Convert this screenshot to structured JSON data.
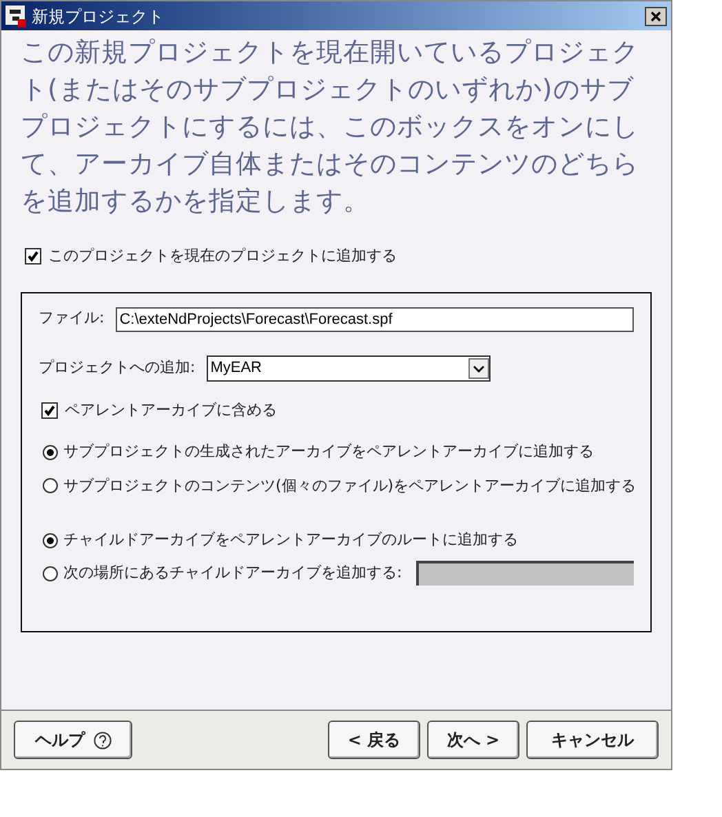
{
  "window": {
    "title": "新規プロジェクト"
  },
  "description": "この新規プロジェクトを現在開いているプロジェクト(またはそのサブプロジェクトのいずれか)のサブプロジェクトにするには、このボックスをオンにして、アーカイブ自体またはそのコンテンツのどちらを追加するかを指定します。",
  "add_to_project": {
    "label": "このプロジェクトを現在のプロジェクトに追加する",
    "checked": true
  },
  "group": {
    "file": {
      "label": "ファイル:",
      "value": "C:\\exteNdProjects\\Forecast\\Forecast.spf"
    },
    "add_to": {
      "label": "プロジェクトへの追加:",
      "value": "MyEAR"
    },
    "include_in_parent": {
      "label": "ペアレントアーカイブに含める",
      "checked": true
    },
    "content_options": [
      {
        "label": "サブプロジェクトの生成されたアーカイブをペアレントアーカイブに追加する",
        "selected": true
      },
      {
        "label": "サブプロジェクトのコンテンツ(個々のファイル)をペアレントアーカイブに追加する",
        "selected": false
      }
    ],
    "location_options": [
      {
        "label": "チャイルドアーカイブをペアレントアーカイブのルートに追加する",
        "selected": true,
        "disabled_field": false
      },
      {
        "label": "次の場所にあるチャイルドアーカイブを追加する:",
        "selected": false,
        "disabled_field": true
      }
    ]
  },
  "buttons": {
    "help": "ヘルプ",
    "back": "< 戻る",
    "next": "次へ >",
    "cancel": "キャンセル"
  }
}
